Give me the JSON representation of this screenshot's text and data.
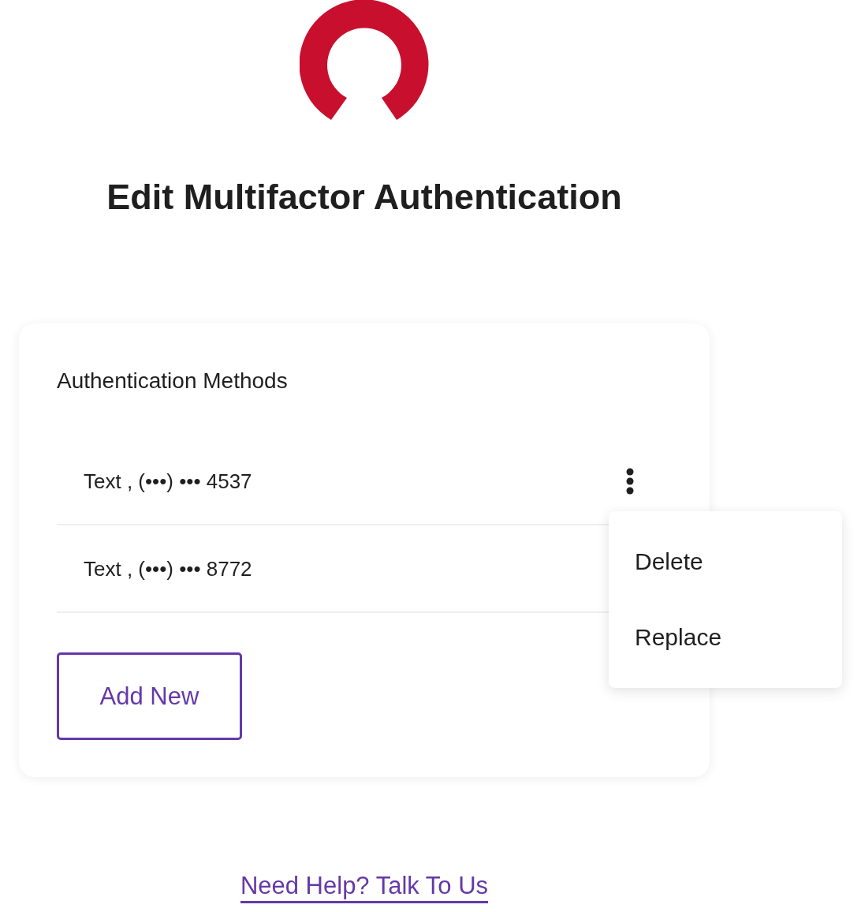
{
  "title": "Edit Multifactor Authentication",
  "card": {
    "heading": "Authentication Methods",
    "methods": [
      {
        "label": "Text , (•••) ••• 4537",
        "menu_open": true,
        "menu": [
          "Delete",
          "Replace"
        ]
      },
      {
        "label": "Text , (•••) ••• 8772",
        "menu_open": false
      }
    ],
    "add_button": "Add New"
  },
  "help_link": "Need Help? Talk To Us"
}
